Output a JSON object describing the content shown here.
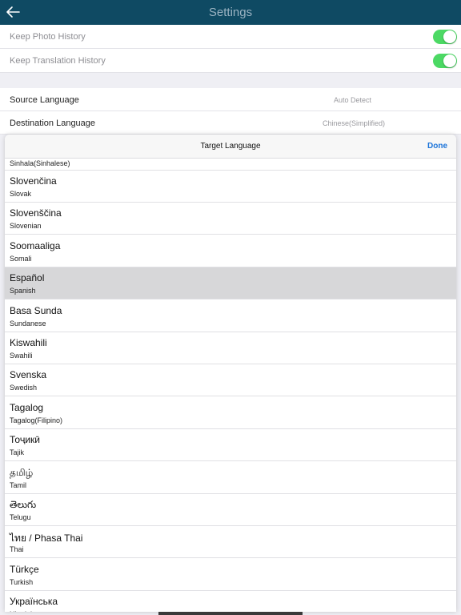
{
  "header": {
    "title": "Settings"
  },
  "settings": {
    "keep_photo_history": {
      "label": "Keep Photo History",
      "enabled": true
    },
    "keep_translation_history": {
      "label": "Keep Translation History",
      "enabled": true
    },
    "source_language": {
      "label": "Source Language",
      "value": "Auto Detect"
    },
    "destination_language": {
      "label": "Destination Language",
      "value": "Chinese(Simplified)"
    }
  },
  "picker": {
    "title": "Target Language",
    "done_label": "Done",
    "partial_top_item": "Sinhala(Sinhalese)",
    "items": [
      {
        "native": "Slovenčina",
        "english": "Slovak"
      },
      {
        "native": "Slovenščina",
        "english": "Slovenian"
      },
      {
        "native": "Soomaaliga",
        "english": "Somali"
      },
      {
        "native": "Español",
        "english": "Spanish",
        "selected": true
      },
      {
        "native": "Basa Sunda",
        "english": "Sundanese"
      },
      {
        "native": "Kiswahili",
        "english": "Swahili"
      },
      {
        "native": "Svenska",
        "english": "Swedish"
      },
      {
        "native": "Tagalog",
        "english": "Tagalog(Filipino)"
      },
      {
        "native": "Тоҷикӣ",
        "english": "Tajik"
      },
      {
        "native": "தமிழ்",
        "english": "Tamil"
      },
      {
        "native": "తెలుగు",
        "english": "Telugu"
      },
      {
        "native": "ไทย / Phasa Thai",
        "english": "Thai"
      },
      {
        "native": "Türkçe",
        "english": "Turkish"
      },
      {
        "native": "Українська",
        "english": "Ukrainian"
      }
    ]
  },
  "colors": {
    "header_bg": "#0f4a63",
    "toggle_on": "#4cd964",
    "accent": "#1a73d9",
    "selected_row": "#d7d7d9"
  }
}
